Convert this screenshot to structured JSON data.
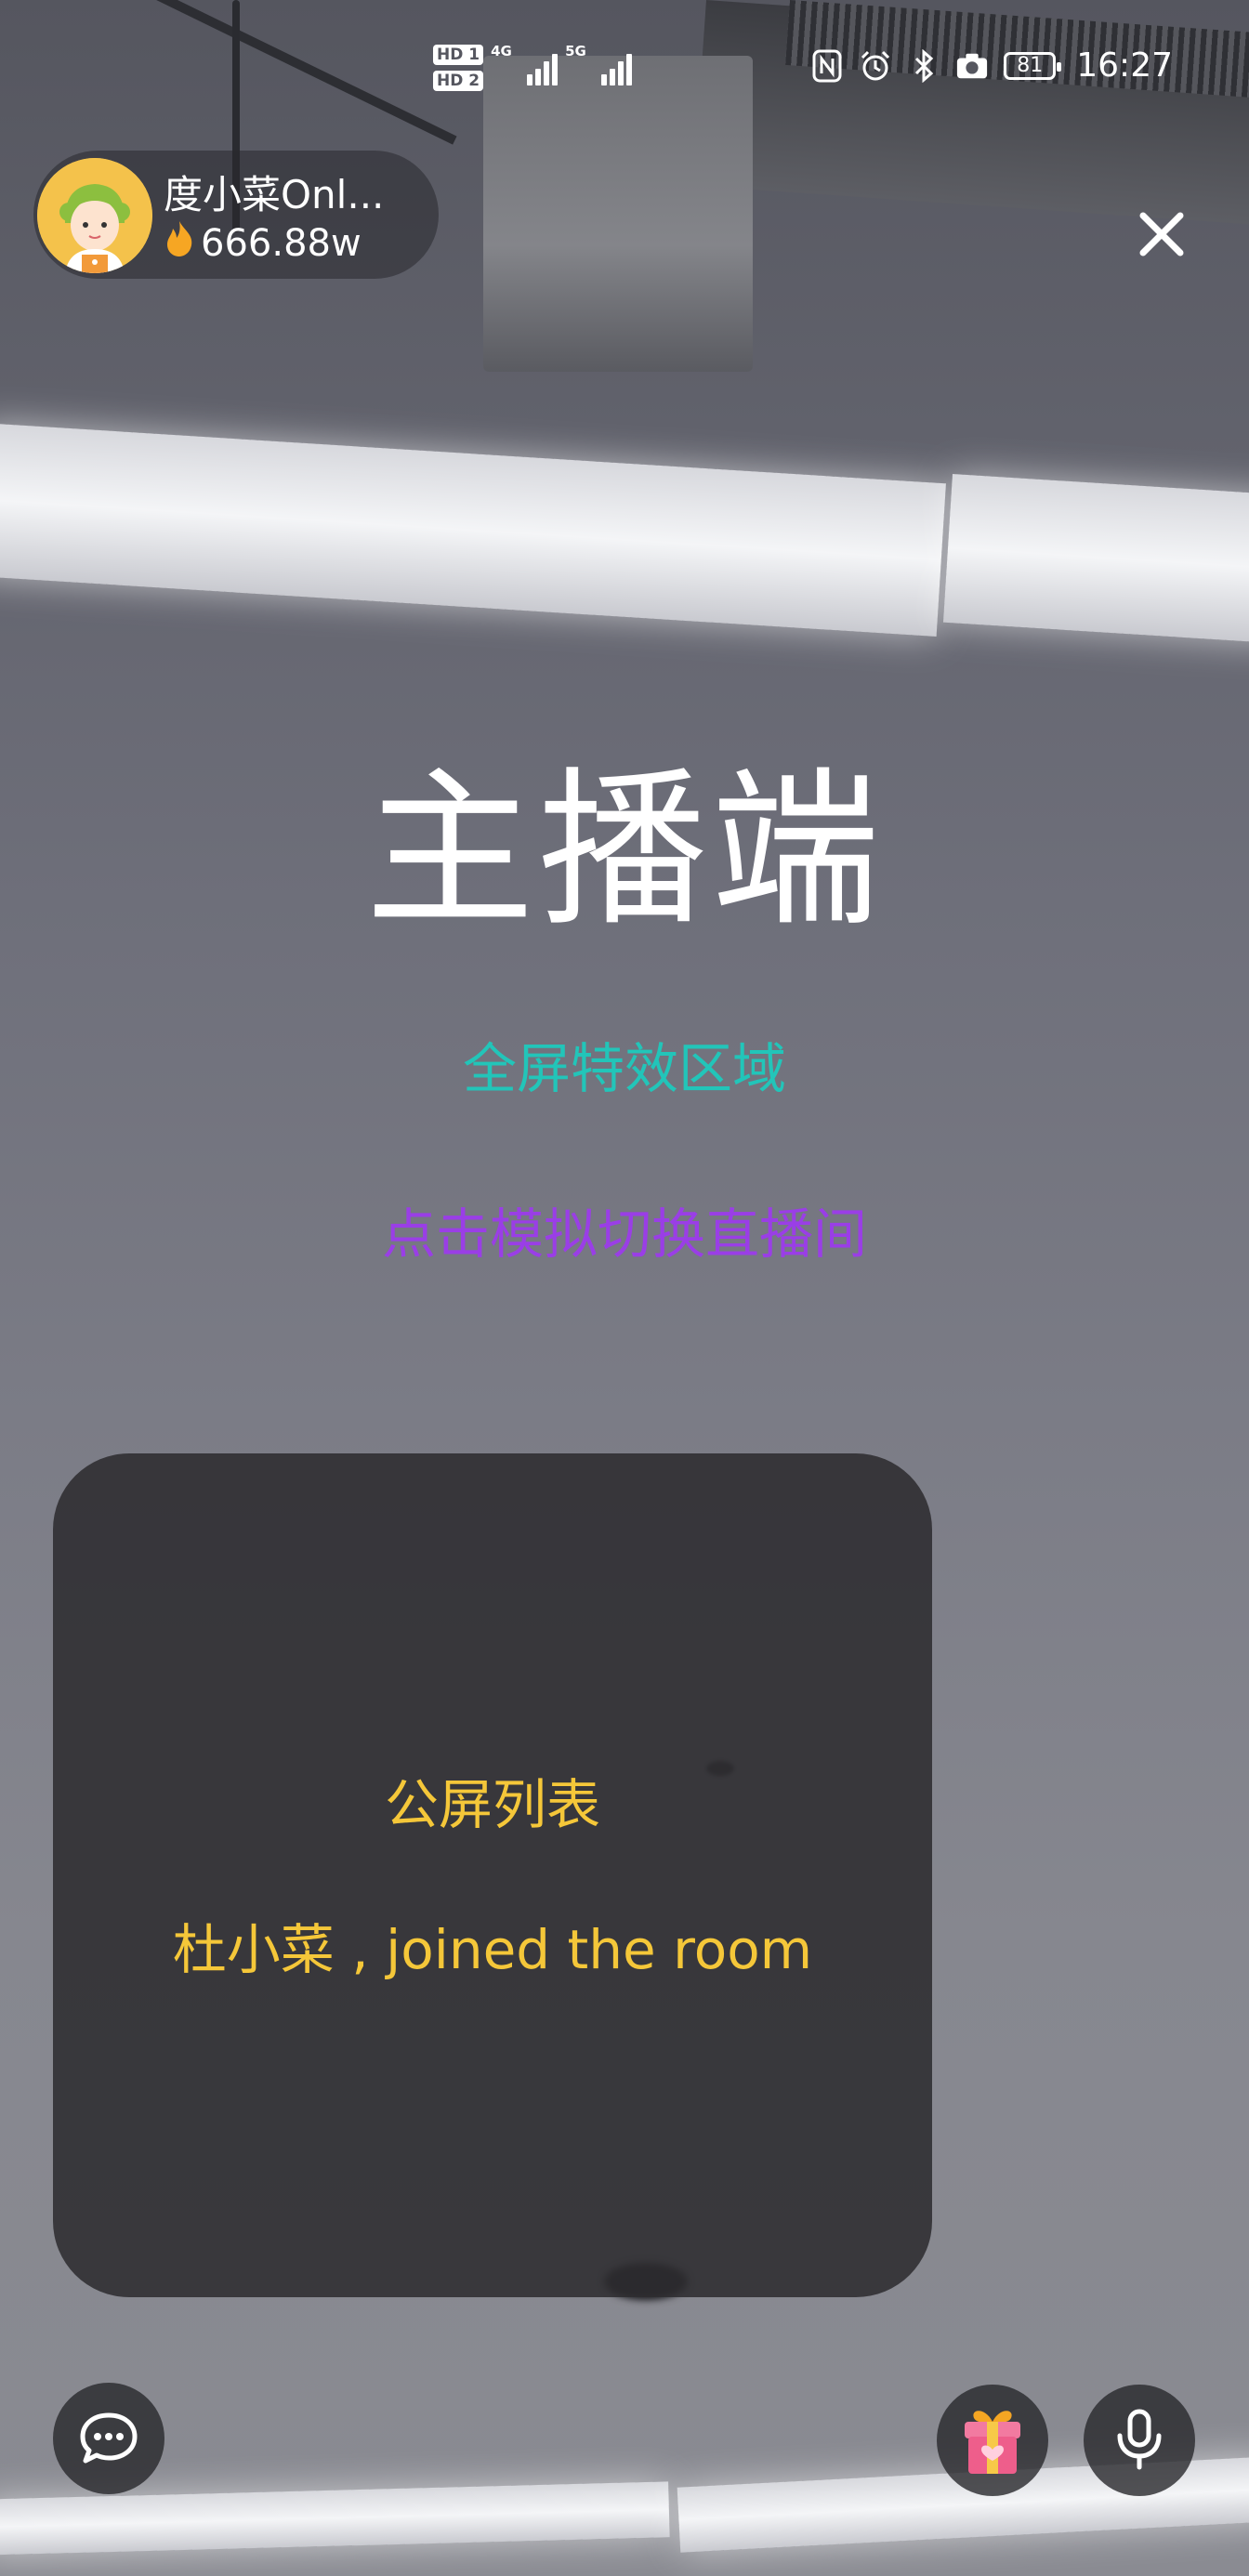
{
  "status_bar": {
    "sim1_tag": "HD 1",
    "sim2_tag": "HD 2",
    "sim1_network": "4G",
    "sim2_network": "5G",
    "battery_level": "81",
    "time": "16:27",
    "icons": [
      "nfc-icon",
      "alarm-icon",
      "bluetooth-icon",
      "camera-icon"
    ]
  },
  "host": {
    "name": "度小菜Onl...",
    "heat": "666.88w"
  },
  "main": {
    "title": "主播端",
    "effect_area_label": "全屏特效区域",
    "switch_room_label": "点击模拟切换直播间"
  },
  "chat_panel": {
    "title": "公屏列表",
    "messages": [
      "杜小菜 , joined the room"
    ]
  },
  "toolbar": {
    "chat_icon": "chat-bubble-icon",
    "gift_icon": "gift-icon",
    "mic_icon": "microphone-icon"
  },
  "colors": {
    "effect_area": "#22c5b9",
    "switch_room": "#9a3ee6",
    "chat_text": "#f5c739"
  }
}
